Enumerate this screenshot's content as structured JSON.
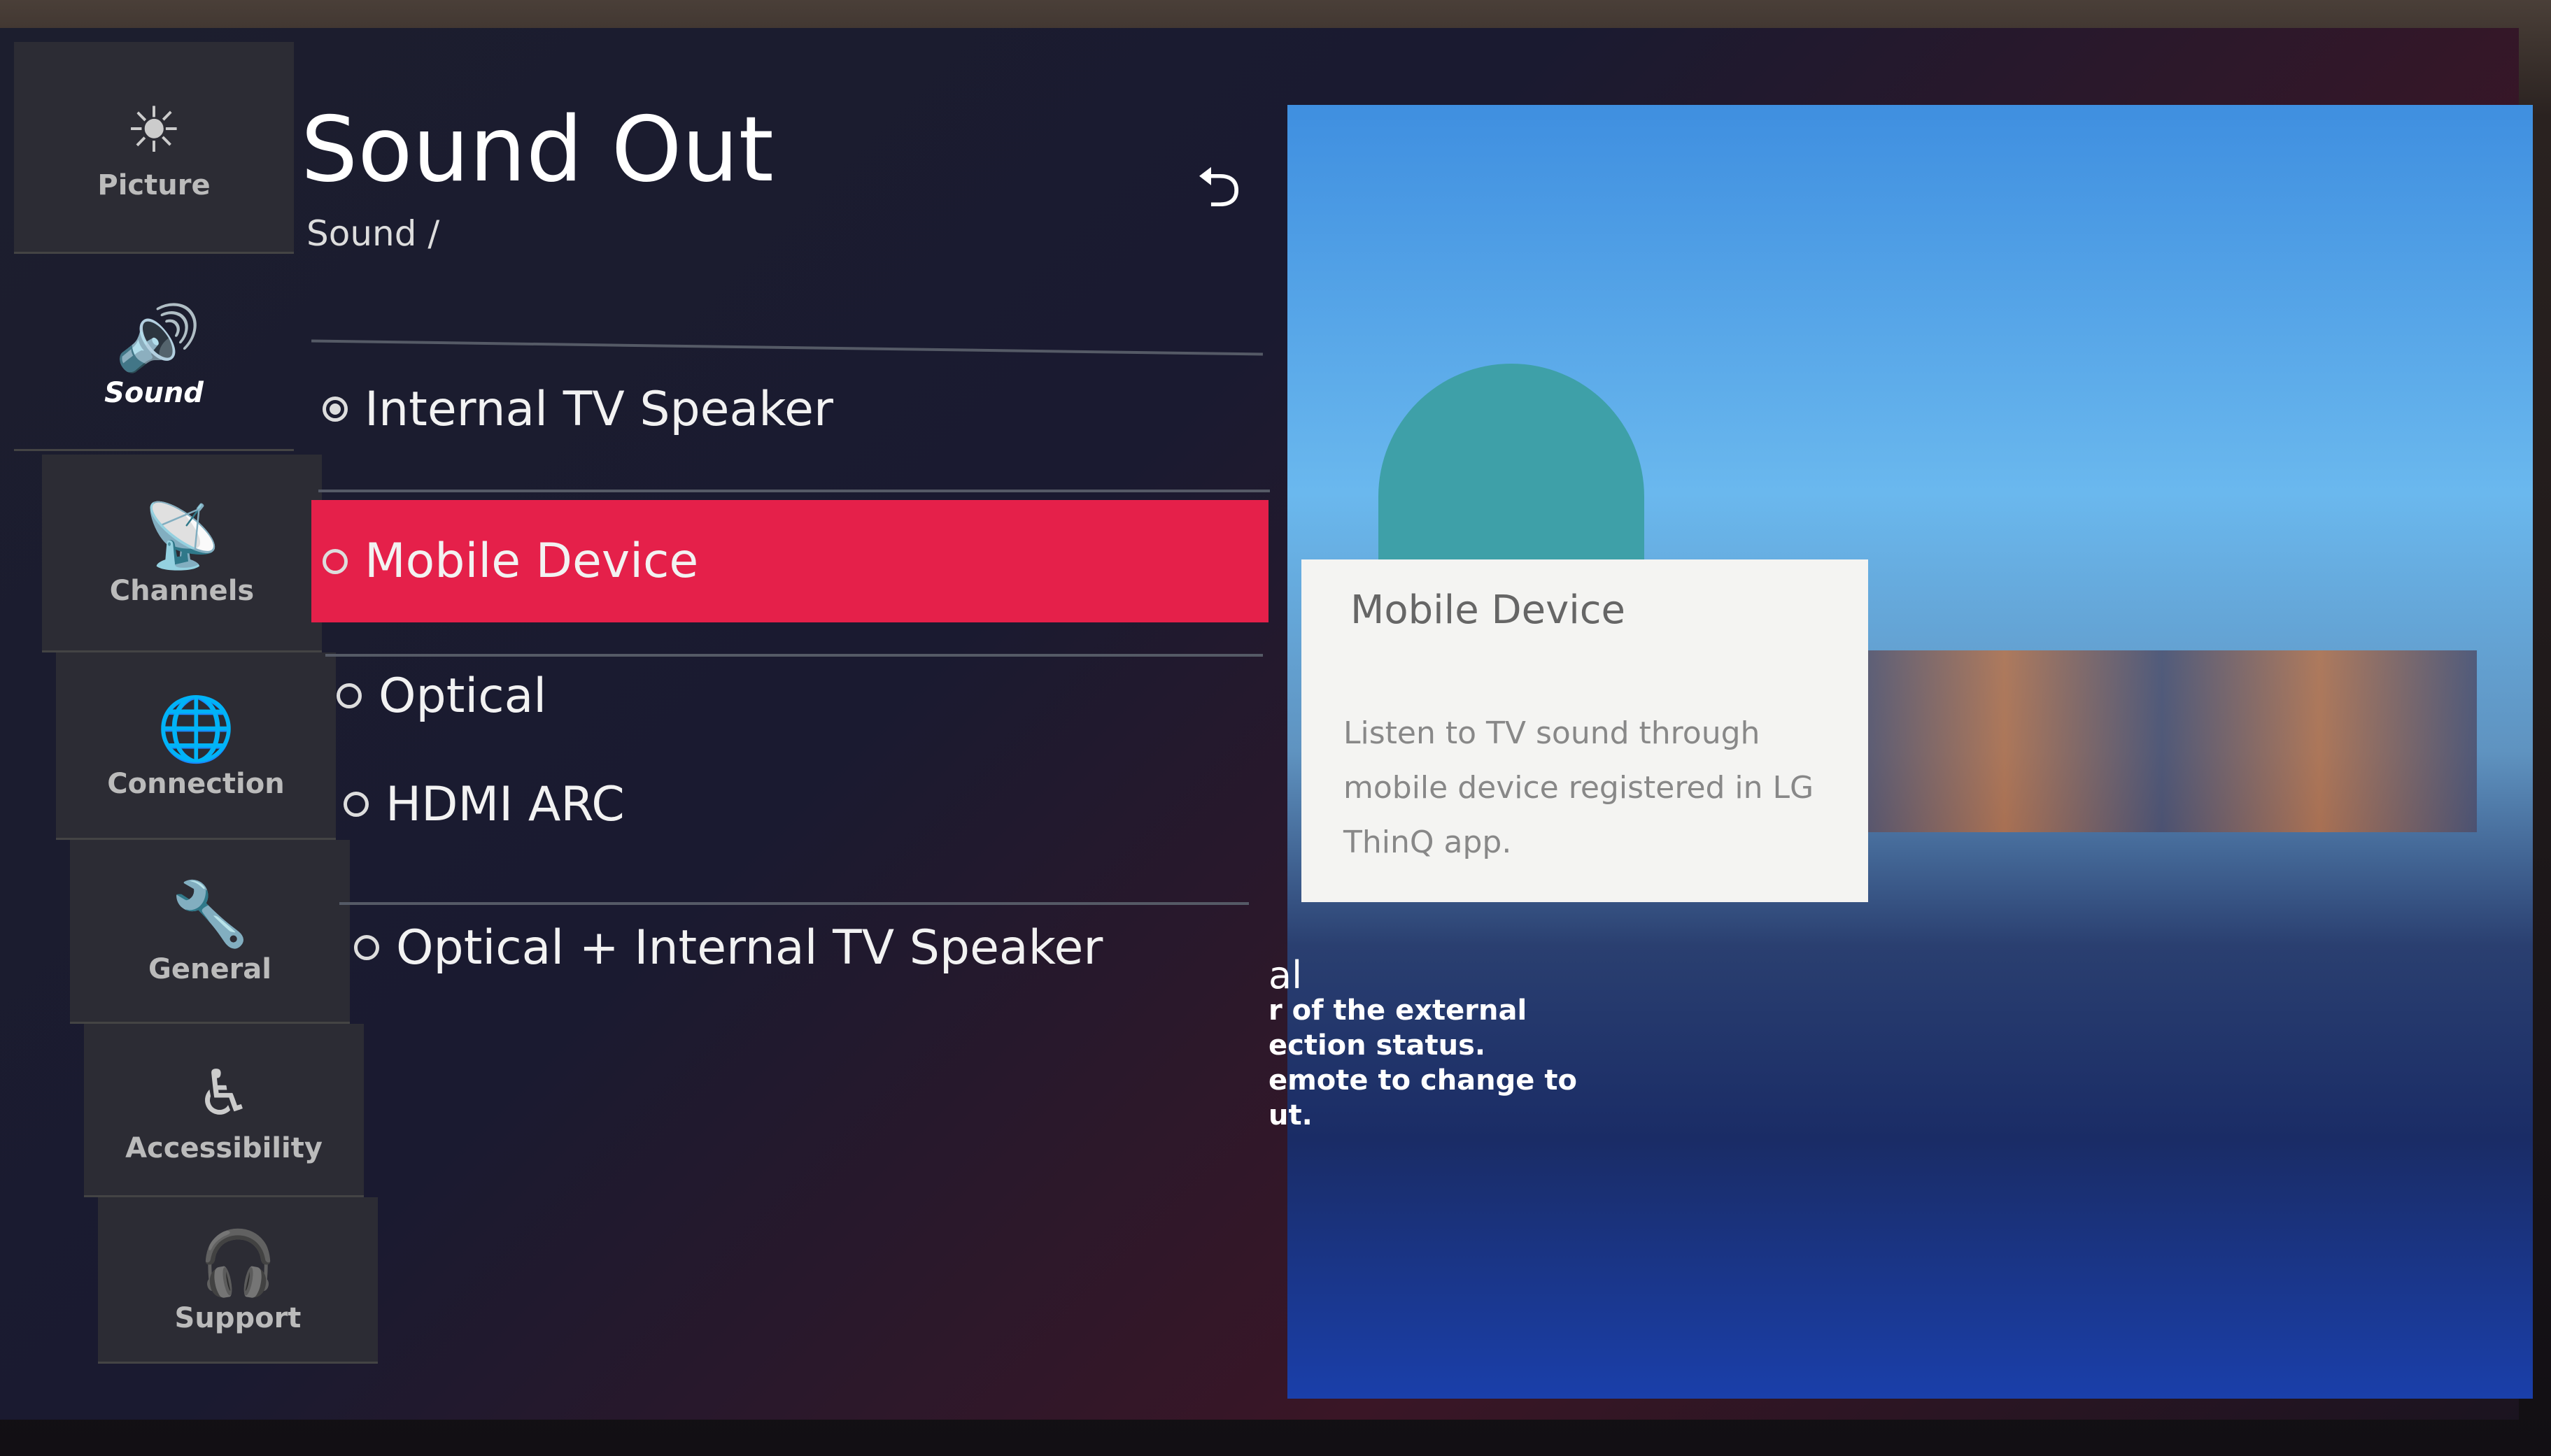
{
  "sidebar": {
    "items": [
      {
        "label": "Picture",
        "icon": "picture-icon",
        "glyph": "☀"
      },
      {
        "label": "Sound",
        "icon": "speaker-icon",
        "glyph": "🔊",
        "active": true
      },
      {
        "label": "Channels",
        "icon": "satellite-dish-icon",
        "glyph": "📡"
      },
      {
        "label": "Connection",
        "icon": "globe-icon",
        "glyph": "🌐"
      },
      {
        "label": "General",
        "icon": "wrench-icon",
        "glyph": "🔧"
      },
      {
        "label": "Accessibility",
        "icon": "accessibility-icon",
        "glyph": "♿"
      },
      {
        "label": "Support",
        "icon": "support-icon",
        "glyph": "🎧"
      }
    ]
  },
  "header": {
    "title": "Sound Out",
    "breadcrumb": "Sound /",
    "back_glyph": "⮌"
  },
  "options": [
    {
      "label": "Internal TV Speaker",
      "checked": true
    },
    {
      "label": "Mobile Device",
      "focused": true
    },
    {
      "label": "Optical"
    },
    {
      "label": "HDMI ARC"
    },
    {
      "label": "Optical + Internal TV Speaker"
    }
  ],
  "tooltip": {
    "title": "Mobile Device",
    "description": "Listen to TV sound through mobile device registered in LG ThinQ app."
  },
  "background_text": {
    "heading": "al",
    "lines": [
      "r of the external",
      "ection status.",
      "emote to change to",
      "ut."
    ]
  },
  "colors": {
    "accent": "#e5204a"
  }
}
